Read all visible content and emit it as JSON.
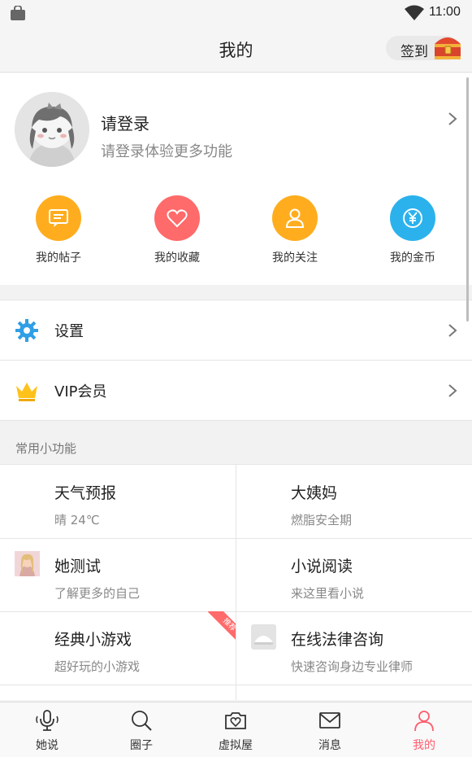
{
  "status_bar": {
    "time": "11:00"
  },
  "header": {
    "title": "我的",
    "checkin_label": "签到"
  },
  "profile": {
    "title": "请登录",
    "subtitle": "请登录体验更多功能",
    "quick_links": [
      {
        "label": "我的帖子",
        "icon": "post-icon",
        "color": "#ffad1e"
      },
      {
        "label": "我的收藏",
        "icon": "heart-icon",
        "color": "#ff6a6a"
      },
      {
        "label": "我的关注",
        "icon": "user-icon",
        "color": "#ffad1e"
      },
      {
        "label": "我的金币",
        "icon": "coin-icon",
        "color": "#2bb2ec"
      }
    ]
  },
  "menu": [
    {
      "label": "设置",
      "icon": "gear-icon"
    },
    {
      "label": "VIP会员",
      "icon": "crown-icon"
    }
  ],
  "features": {
    "section_title": "常用小功能",
    "items": [
      {
        "title": "天气预报",
        "subtitle": "晴 24℃"
      },
      {
        "title": "大姨妈",
        "subtitle": "燃脂安全期"
      },
      {
        "title": "她测试",
        "subtitle": "了解更多的自己",
        "icon": "portrait-icon"
      },
      {
        "title": "小说阅读",
        "subtitle": "来这里看小说"
      },
      {
        "title": "经典小游戏",
        "subtitle": "超好玩的小游戏",
        "badge": "推荐"
      },
      {
        "title": "在线法律咨询",
        "subtitle": "快速咨询身边专业律师",
        "icon": "legal-icon"
      }
    ]
  },
  "tabbar": {
    "tabs": [
      {
        "label": "她说",
        "icon": "microphone-icon"
      },
      {
        "label": "圈子",
        "icon": "search-icon"
      },
      {
        "label": "虚拟屋",
        "icon": "camera-heart-icon"
      },
      {
        "label": "消息",
        "icon": "envelope-icon"
      },
      {
        "label": "我的",
        "icon": "person-icon",
        "active": true
      }
    ],
    "active_color": "#ff5c6c"
  }
}
